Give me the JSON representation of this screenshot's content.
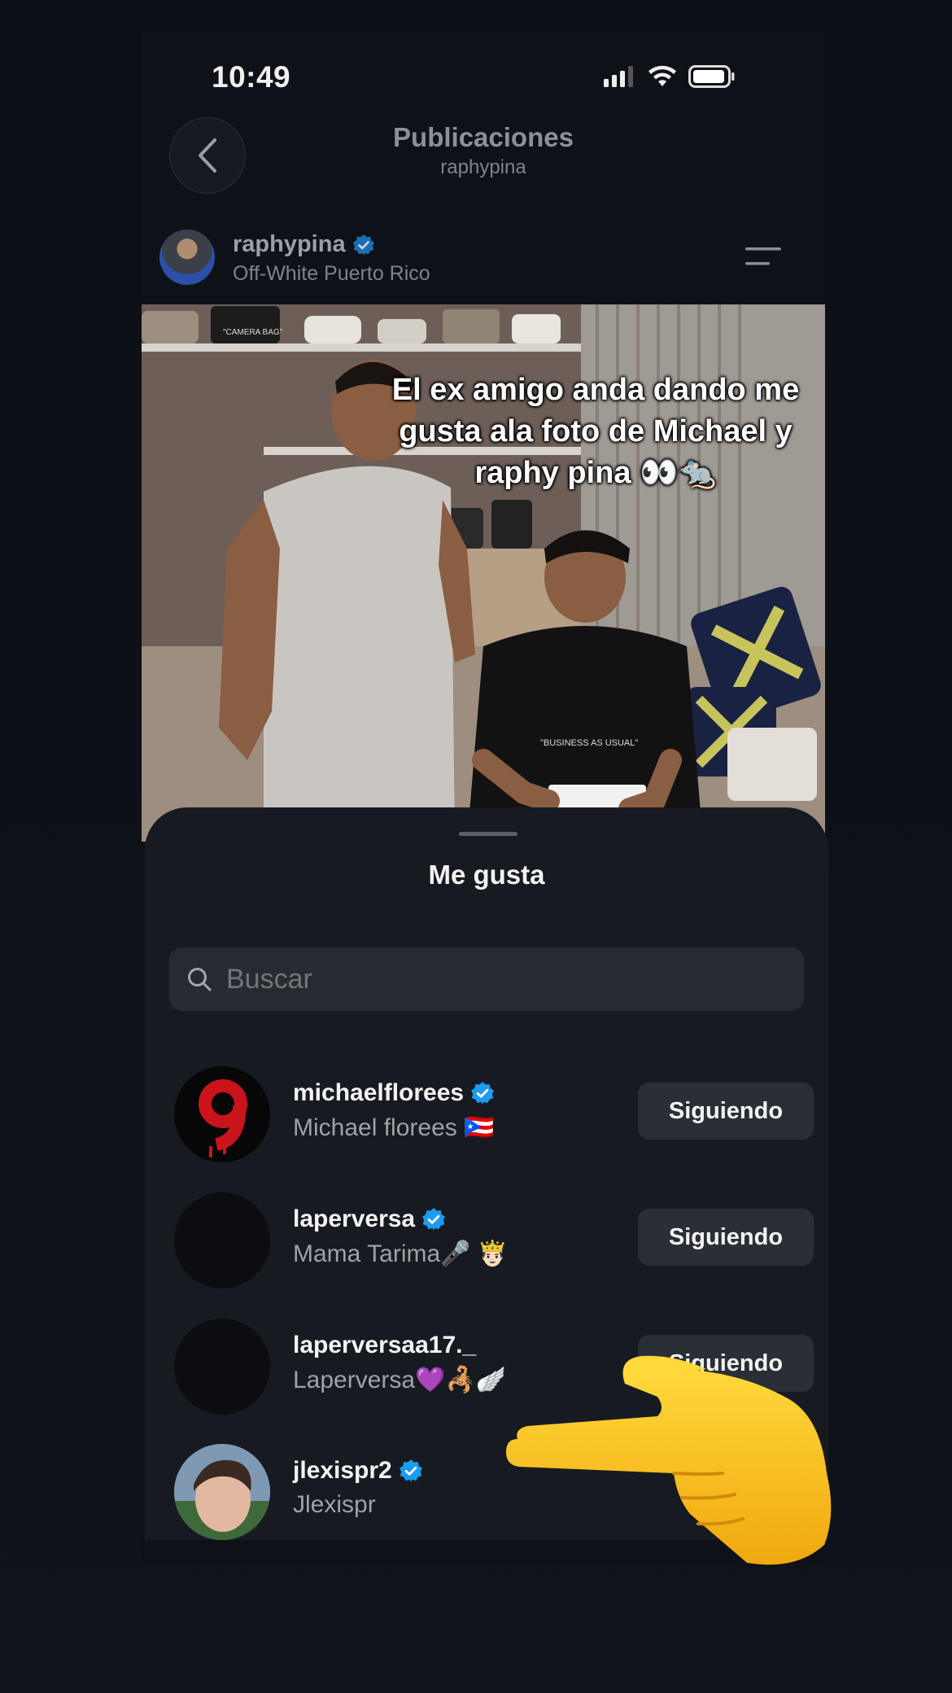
{
  "status_bar": {
    "time": "10:49"
  },
  "header": {
    "title": "Publicaciones",
    "subtitle": "raphypina"
  },
  "post": {
    "username": "raphypina",
    "location": "Off-White Puerto Rico",
    "overlay_caption": "El ex amigo anda dando me gusta ala foto de Michael y raphy pina 👀🐀",
    "shirt_text": "\"BUSINESS AS USUAL\"",
    "bag_text": "\"CAMERA BAG\""
  },
  "likes_sheet": {
    "title": "Me gusta",
    "search_placeholder": "Buscar",
    "users": [
      {
        "username": "michaelflorees",
        "display_name": "Michael florees 🇵🇷",
        "verified": true,
        "button": "Siguiendo"
      },
      {
        "username": "laperversa",
        "display_name": "Mama Tarima🎤 🤴🏻",
        "verified": true,
        "button": "Siguiendo"
      },
      {
        "username": "laperversaa17._",
        "display_name": "Laperversa💜🦂🪽",
        "verified": false,
        "button": "Siguiendo"
      },
      {
        "username": "jlexispr2",
        "display_name": "Jlexispr",
        "verified": true,
        "button": ""
      }
    ]
  },
  "colors": {
    "verified_blue": "#1d9bf0",
    "sheet_bg": "#171b21",
    "button_bg": "#2a2f37",
    "hand": "#f7c21e"
  }
}
